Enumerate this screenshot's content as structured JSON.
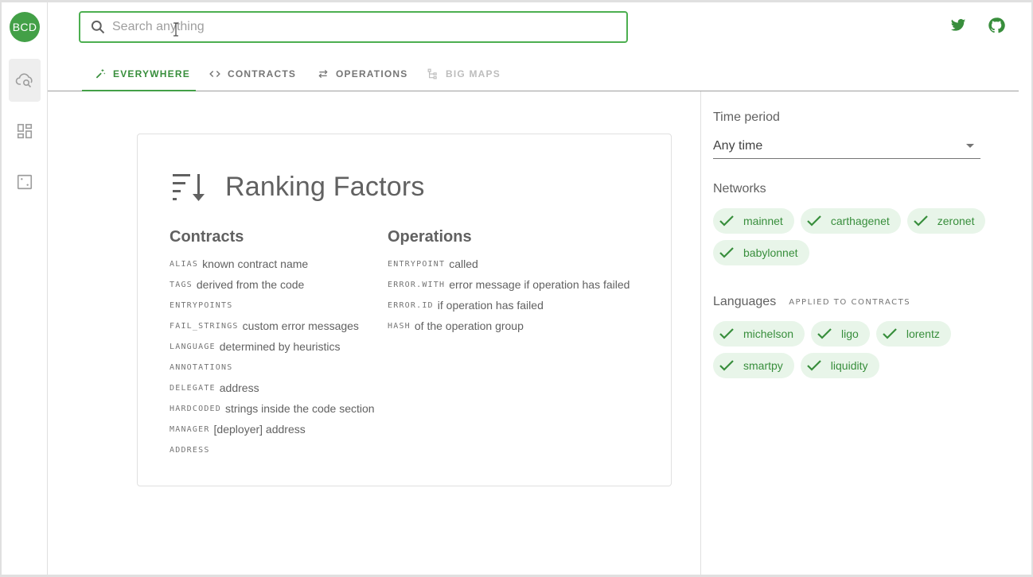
{
  "rail": {
    "avatar_text": "BCD",
    "items": [
      {
        "icon": "cloud-search-icon",
        "active": true
      },
      {
        "icon": "dashboard-icon",
        "active": false
      },
      {
        "icon": "dice-icon",
        "active": false
      }
    ]
  },
  "search": {
    "placeholder": "Search anything",
    "value": ""
  },
  "header_icons": [
    "twitter-icon",
    "github-icon"
  ],
  "tabs": [
    {
      "label": "EVERYWHERE",
      "icon": "magic-wand-icon",
      "state": "active"
    },
    {
      "label": "CONTRACTS",
      "icon": "code-icon",
      "state": "normal"
    },
    {
      "label": "OPERATIONS",
      "icon": "swap-icon",
      "state": "normal"
    },
    {
      "label": "BIG MAPS",
      "icon": "tree-icon",
      "state": "disabled"
    }
  ],
  "card": {
    "title": "Ranking Factors",
    "title_icon": "sort-descending-icon",
    "contracts": {
      "heading": "Contracts",
      "rows": [
        {
          "key": "ALIAS",
          "text": "known contract name"
        },
        {
          "key": "TAGS",
          "text": "derived from the code"
        },
        {
          "key": "ENTRYPOINTS",
          "text": ""
        },
        {
          "key": "FAIL_STRINGS",
          "text": "custom error messages"
        },
        {
          "key": "LANGUAGE",
          "text": "determined by heuristics"
        },
        {
          "key": "ANNOTATIONS",
          "text": ""
        },
        {
          "key": "DELEGATE",
          "text": "address"
        },
        {
          "key": "HARDCODED",
          "text": "strings inside the code section"
        },
        {
          "key": "MANAGER",
          "text": "[deployer] address"
        },
        {
          "key": "ADDRESS",
          "text": ""
        }
      ]
    },
    "operations": {
      "heading": "Operations",
      "rows": [
        {
          "key": "ENTRYPOINT",
          "text": "called"
        },
        {
          "key": "ERROR.WITH",
          "text": "error message if operation has failed"
        },
        {
          "key": "ERROR.ID",
          "text": "if operation has failed"
        },
        {
          "key": "HASH",
          "text": "of the operation group"
        }
      ]
    }
  },
  "filters": {
    "time_period_label": "Time period",
    "time_period_value": "Any time",
    "networks_label": "Networks",
    "networks": [
      "mainnet",
      "carthagenet",
      "zeronet",
      "babylonnet"
    ],
    "languages_label": "Languages",
    "languages_sublabel": "APPLIED TO CONTRACTS",
    "languages": [
      "michelson",
      "ligo",
      "lorentz",
      "smartpy",
      "liquidity"
    ]
  },
  "colors": {
    "accent": "#43a047",
    "chip_bg": "#e8f5e9",
    "chip_text": "#388e3c"
  }
}
